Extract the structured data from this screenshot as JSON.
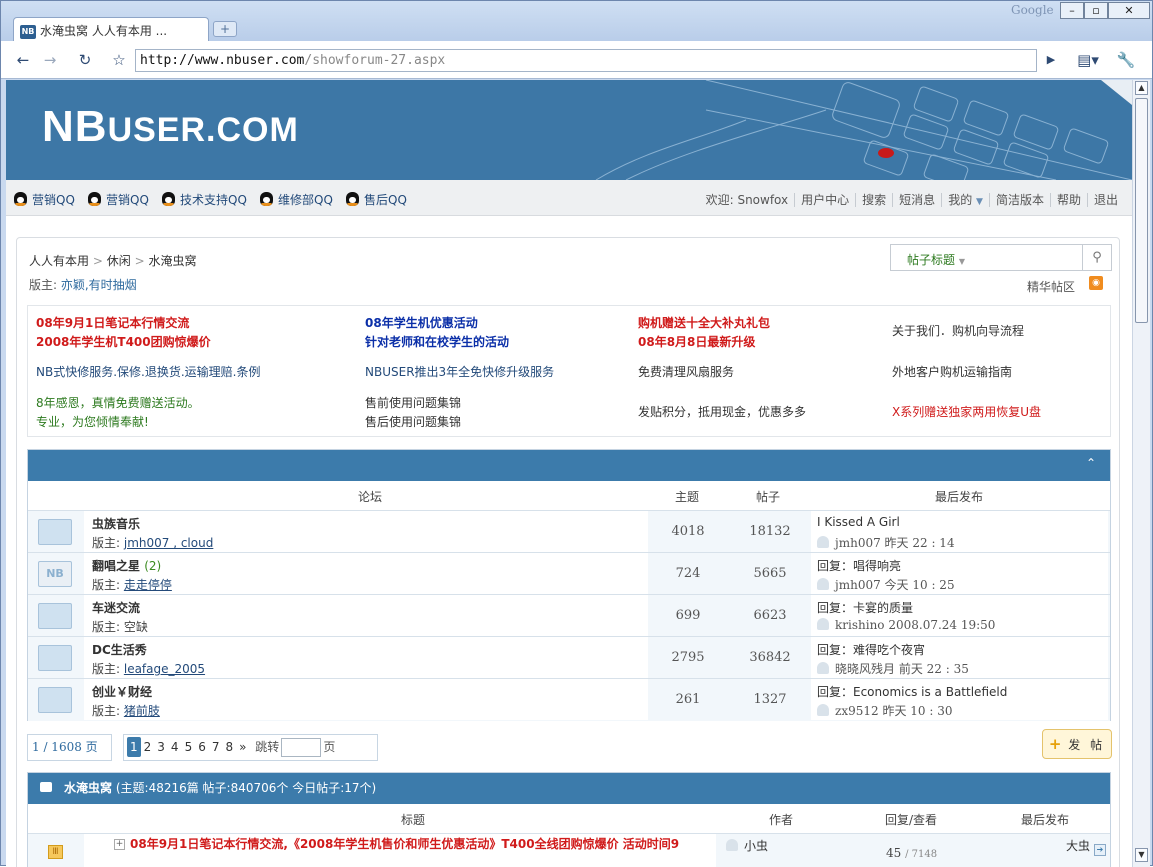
{
  "browser": {
    "tab_title": "水淹虫窝 人人有本用 ...",
    "brand": "Google",
    "url_host": "http://www.nbuser.com",
    "url_path": "/showforum-27.aspx"
  },
  "site": {
    "logo_main": "NB",
    "logo_rest": "USER.COM"
  },
  "qq_links": [
    "营销QQ",
    "营销QQ",
    "技术支持QQ",
    "维修部QQ",
    "售后QQ"
  ],
  "user_menu": {
    "welcome": "欢迎: Snowfox",
    "items": [
      "用户中心",
      "搜索",
      "短消息",
      "我的",
      "简洁版本",
      "帮助",
      "退出"
    ]
  },
  "breadcrumb": {
    "root": "人人有本用",
    "sep": ">",
    "level1": "休闲",
    "level2": "水淹虫窝"
  },
  "moderators": {
    "label": "版主: ",
    "value": "亦颖,有时抽烟"
  },
  "search": {
    "selected": "帖子标题",
    "digest": "精华帖区"
  },
  "ads": {
    "col1": [
      "08年9月1日笔记本行情交流",
      "2008年学生机T400团购惊爆价",
      "NB式快修服务.保修.退换货.运输理赔.条例",
      "8年感恩，真情免费赠送活动。",
      "专业，为您倾情奉献!"
    ],
    "col2": [
      "08年学生机优惠活动",
      "针对老师和在校学生的活动",
      "NBUSER推出3年全免快修升级服务",
      "售前使用问题集锦",
      "售后使用问题集锦"
    ],
    "col3": [
      "购机赠送十全大补丸礼包",
      "08年8月8日最新升级",
      "免费清理风扇服务",
      "发贴积分，抵用现金，优惠多多"
    ],
    "col4": [
      "关于我们．购机向导流程",
      "外地客户购机运输指南",
      "X系列赠送独家两用恢复U盘"
    ]
  },
  "forum_table": {
    "headers": {
      "forum": "论坛",
      "topics": "主题",
      "posts": "帖子",
      "last": "最后发布"
    },
    "mod_label": "版主: ",
    "rows": [
      {
        "name": "虫族音乐",
        "count": "",
        "mods": "jmh007 , cloud",
        "topics": "4018",
        "posts": "18132",
        "last_title": "I Kissed A Girl",
        "last_by": "jmh007 昨天 22 : 14"
      },
      {
        "name": "翻唱之星",
        "count": "(2)",
        "mods": "走走停停",
        "topics": "724",
        "posts": "5665",
        "last_title": "回复：唱得响亮",
        "last_by": "jmh007 今天 10 : 25"
      },
      {
        "name": "车迷交流",
        "count": "",
        "mods": "空缺",
        "topics": "699",
        "posts": "6623",
        "last_title": "回复：卡宴的质量",
        "last_by": "krishino 2008.07.24 19:50"
      },
      {
        "name": "DC生活秀",
        "count": "",
        "mods": "leafage_2005",
        "topics": "2795",
        "posts": "36842",
        "last_title": "回复：难得吃个夜宵",
        "last_by": "晓晓风残月 前天 22 : 35"
      },
      {
        "name": "创业￥财经",
        "count": "",
        "mods": "猪前肢",
        "topics": "261",
        "posts": "1327",
        "last_title": "回复：Economics is a Battlefield",
        "last_by": "zx9512 昨天 10 : 30"
      }
    ]
  },
  "pagination": {
    "summary": "1 / 1608 页",
    "pages": [
      "1",
      "2",
      "3",
      "4",
      "5",
      "6",
      "7",
      "8",
      "»"
    ],
    "jump_label": "跳转",
    "page_unit": "页",
    "post_button": "发 帖"
  },
  "thread_list": {
    "forum_name": "水淹虫窝",
    "stats": "(主题:48216篇 帖子:840706个 今日帖子:17个)",
    "headers": {
      "title": "标题",
      "author": "作者",
      "replies": "回复/查看",
      "last": "最后发布"
    },
    "first": {
      "title": "08年9月1日笔记本行情交流,《2008年学生机售价和师生优惠活动》T400全线团购惊爆价 活动时间9",
      "author": "小虫",
      "replies": "45",
      "views": "7148",
      "last_by": "大虫"
    }
  },
  "colors": {
    "banner": "#3d77a6",
    "header_blue": "#3c7bab",
    "red_link": "#d01b1b",
    "green_link": "#2d7a1f"
  }
}
